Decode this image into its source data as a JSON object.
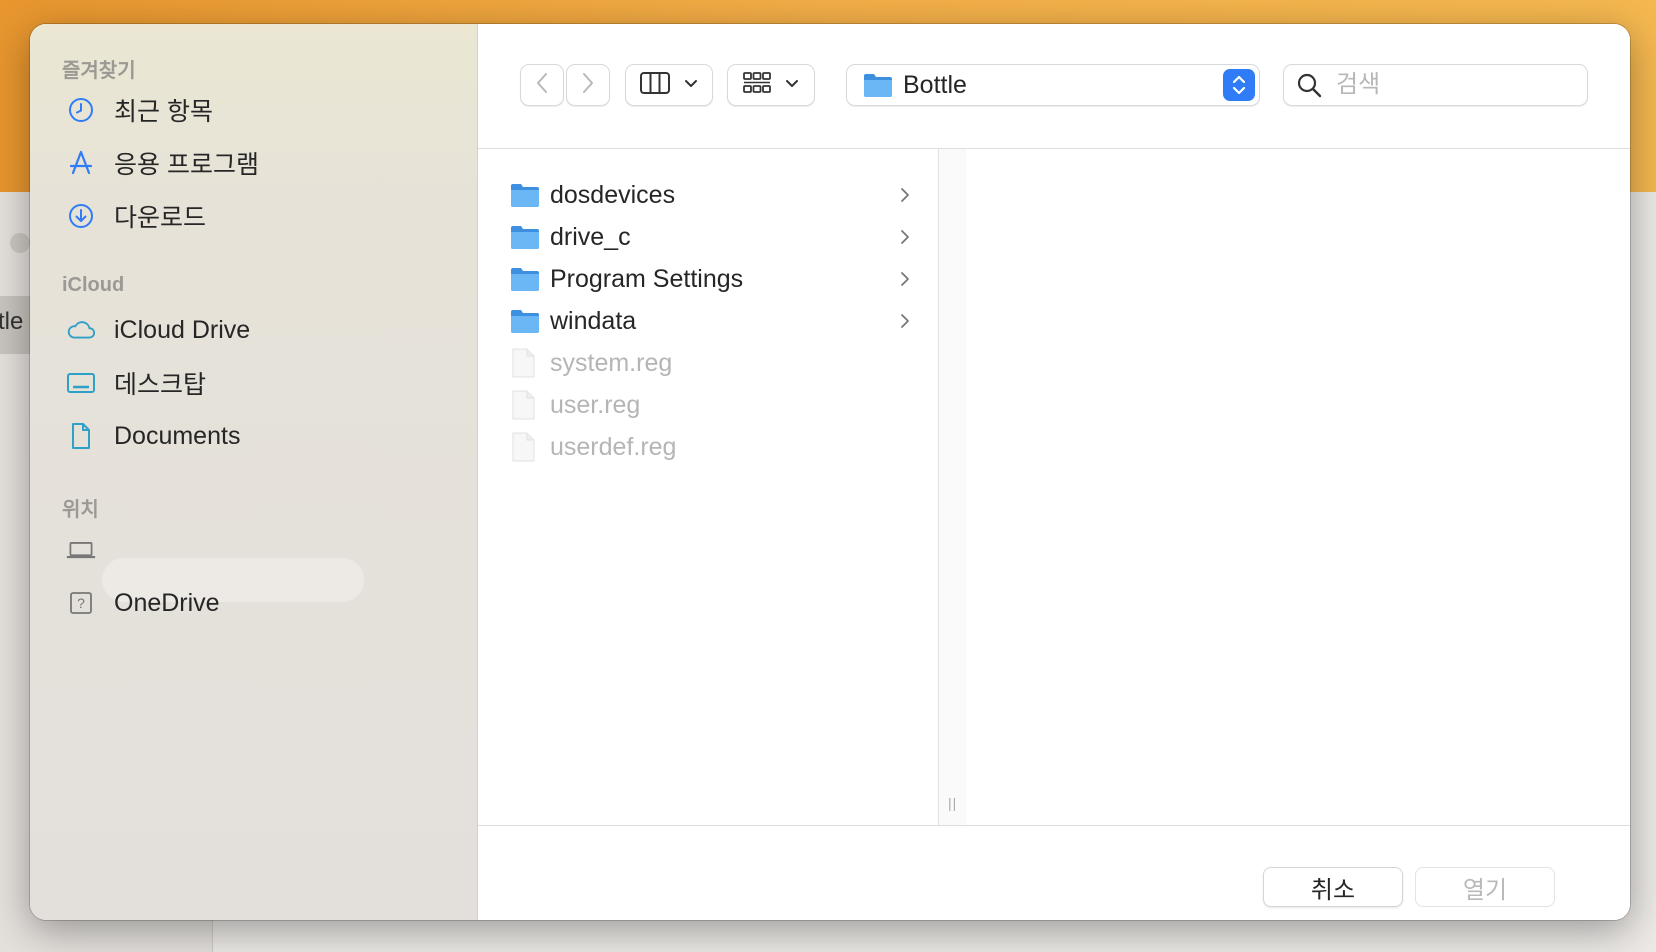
{
  "background": {
    "partial_text": "tle"
  },
  "sidebar": {
    "favorites_title": "즐겨찾기",
    "favorites": [
      {
        "label": "최근 항목",
        "icon": "clock-icon"
      },
      {
        "label": "응용 프로그램",
        "icon": "applications-icon"
      },
      {
        "label": "다운로드",
        "icon": "download-icon"
      }
    ],
    "icloud_title": "iCloud",
    "icloud": [
      {
        "label": "iCloud Drive",
        "icon": "cloud-icon"
      },
      {
        "label": "데스크탑",
        "icon": "desktop-icon"
      },
      {
        "label": "Documents",
        "icon": "document-icon"
      }
    ],
    "locations_title": "위치",
    "locations": [
      {
        "label": "",
        "icon": "laptop-icon"
      },
      {
        "label": "OneDrive",
        "icon": "question-drive-icon"
      }
    ]
  },
  "toolbar": {
    "back_icon": "chevron-left-icon",
    "forward_icon": "chevron-right-icon",
    "view_icon": "columns-view-icon",
    "group_icon": "grid-group-icon",
    "location": "Bottle",
    "search_placeholder": "검색"
  },
  "files": [
    {
      "name": "dosdevices",
      "type": "folder",
      "enabled": true
    },
    {
      "name": "drive_c",
      "type": "folder",
      "enabled": true
    },
    {
      "name": "Program Settings",
      "type": "folder",
      "enabled": true
    },
    {
      "name": "windata",
      "type": "folder",
      "enabled": true
    },
    {
      "name": "system.reg",
      "type": "file",
      "enabled": false
    },
    {
      "name": "user.reg",
      "type": "file",
      "enabled": false
    },
    {
      "name": "userdef.reg",
      "type": "file",
      "enabled": false
    }
  ],
  "footer": {
    "cancel_label": "취소",
    "open_label": "열기"
  },
  "colors": {
    "accent": "#2f7cf6",
    "folder": "#5aa9ec",
    "sidebar_icon": "#2f7cf6"
  }
}
